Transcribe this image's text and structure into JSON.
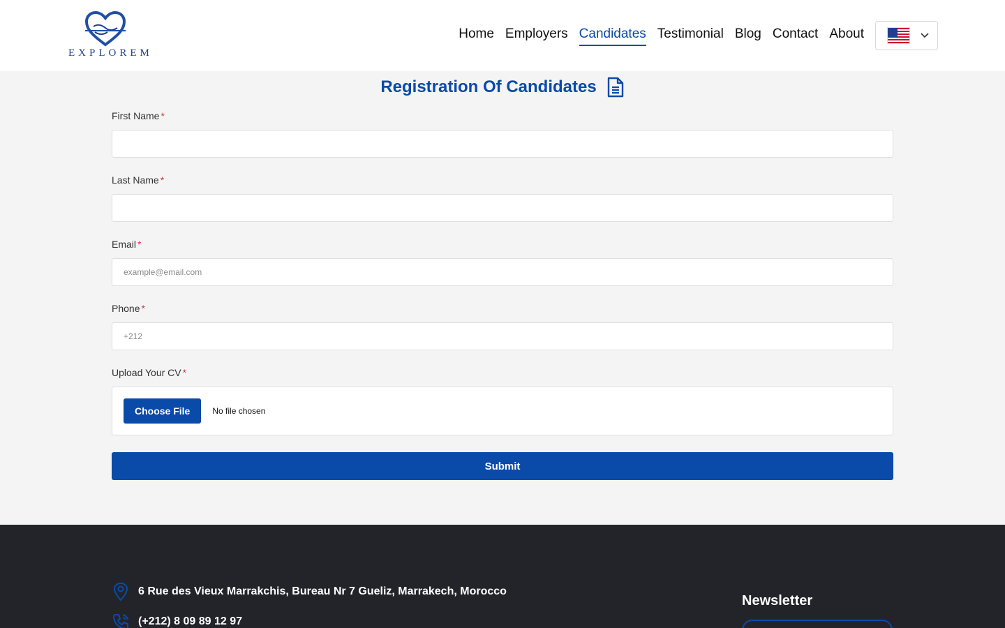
{
  "brand": {
    "name": "EXPLOREM"
  },
  "nav": {
    "items": [
      {
        "label": "Home"
      },
      {
        "label": "Employers"
      },
      {
        "label": "Candidates"
      },
      {
        "label": "Testimonial"
      },
      {
        "label": "Blog"
      },
      {
        "label": "Contact"
      },
      {
        "label": "About"
      }
    ],
    "active": "Candidates",
    "language_icon": "us-flag-icon"
  },
  "form": {
    "title": "Registration Of Candidates",
    "title_icon": "document-icon",
    "required_marker": "*",
    "first_name": {
      "label": "First Name",
      "value": "",
      "placeholder": ""
    },
    "last_name": {
      "label": "Last Name",
      "value": "",
      "placeholder": ""
    },
    "email": {
      "label": "Email",
      "value": "",
      "placeholder": "example@email.com"
    },
    "phone": {
      "label": "Phone",
      "value": "",
      "placeholder": "+212"
    },
    "cv": {
      "label": "Upload Your CV",
      "button_label": "Choose File",
      "status": "No file chosen"
    },
    "submit_label": "Submit"
  },
  "footer": {
    "address": "6 Rue des Vieux Marrakchis, Bureau Nr 7 Gueliz, Marrakech, Morocco",
    "phone": "(+212) 8 09 89 12 97",
    "newsletter_title": "Newsletter"
  },
  "colors": {
    "primary": "#0a4aa8",
    "footer_bg": "#23242a",
    "page_bg": "#f4f4f4",
    "required": "#d9363e"
  }
}
